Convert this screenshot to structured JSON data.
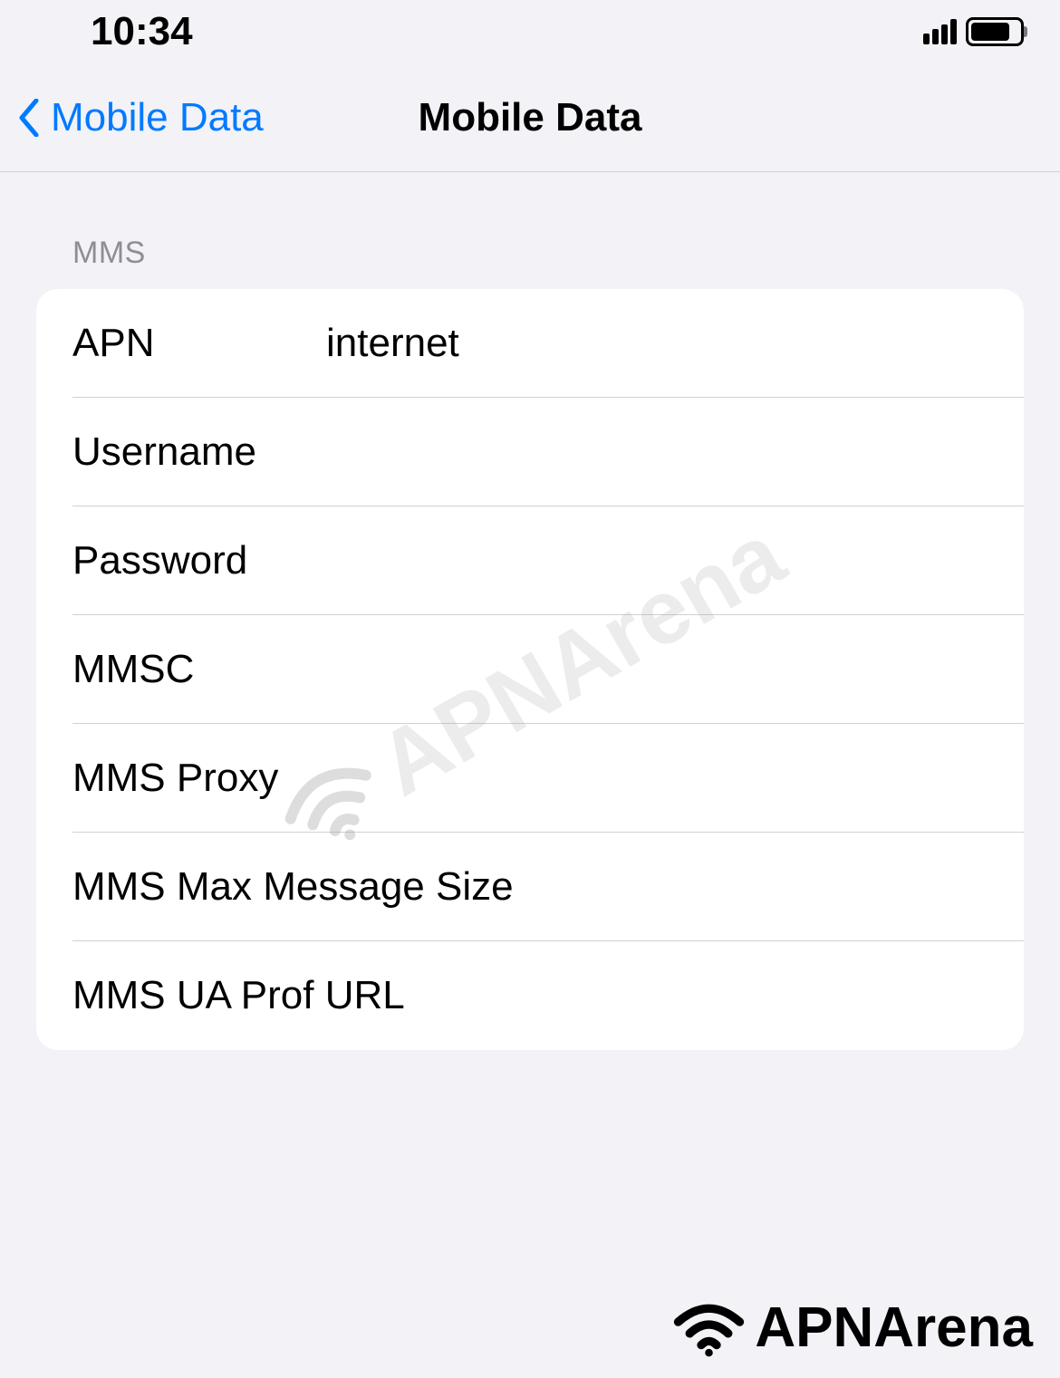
{
  "statusBar": {
    "time": "10:34"
  },
  "navBar": {
    "backLabel": "Mobile Data",
    "title": "Mobile Data"
  },
  "section": {
    "header": "MMS",
    "rows": {
      "apn": {
        "label": "APN",
        "value": "internet"
      },
      "username": {
        "label": "Username",
        "value": ""
      },
      "password": {
        "label": "Password",
        "value": ""
      },
      "mmsc": {
        "label": "MMSC",
        "value": ""
      },
      "mmsProxy": {
        "label": "MMS Proxy",
        "value": ""
      },
      "mmsMaxSize": {
        "label": "MMS Max Message Size",
        "value": ""
      },
      "mmsUaProf": {
        "label": "MMS UA Prof URL",
        "value": ""
      }
    }
  },
  "watermark": {
    "text": "APNArena"
  },
  "footer": {
    "logoText": "APNArena"
  }
}
